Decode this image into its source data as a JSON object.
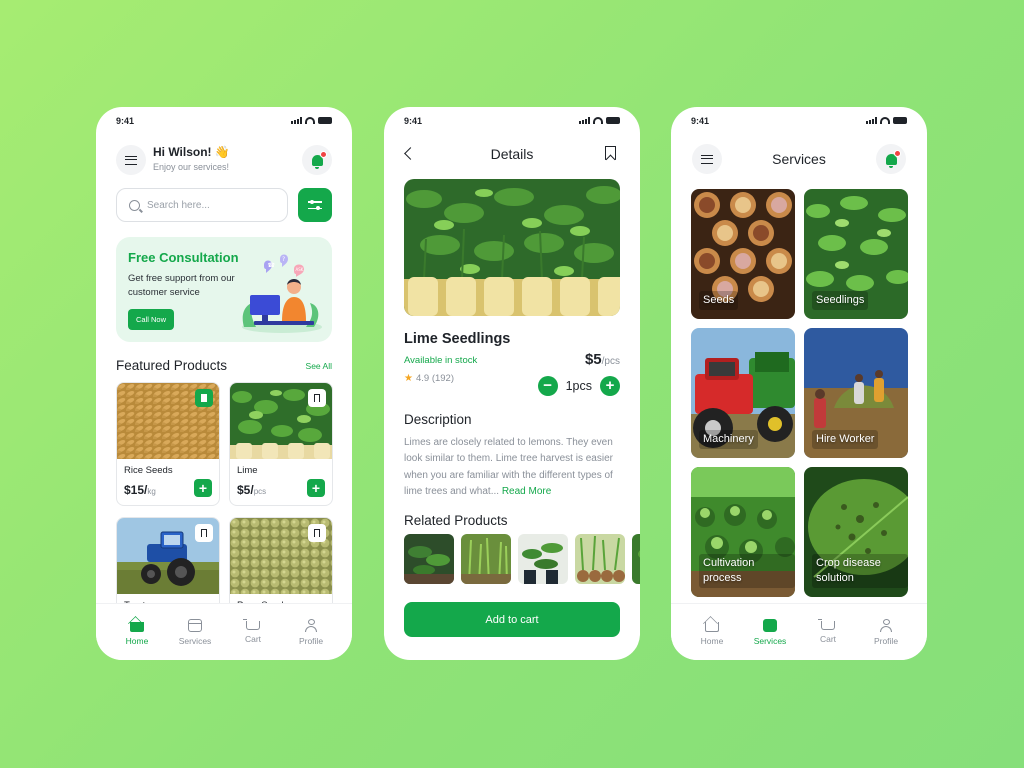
{
  "status": {
    "time": "9:41"
  },
  "home": {
    "greeting": "Hi Wilson! 👋",
    "subtitle": "Enjoy our services!",
    "search_placeholder": "Search here...",
    "banner": {
      "title": "Free Consultation",
      "text": "Get free support from our customer service",
      "button": "Call Now"
    },
    "featured_title": "Featured Products",
    "see_all": "See All",
    "products": [
      {
        "name": "Rice Seeds",
        "price": "$15/",
        "unit": "kg",
        "bookmarked": true
      },
      {
        "name": "Lime",
        "price": "$5/",
        "unit": "pcs",
        "bookmarked": false
      },
      {
        "name": "Tractor",
        "price": "",
        "unit": "",
        "bookmarked": false
      },
      {
        "name": "Peas Seeds",
        "price": "",
        "unit": "",
        "bookmarked": false
      }
    ]
  },
  "tabs": [
    {
      "label": "Home",
      "icon": "home-icon"
    },
    {
      "label": "Services",
      "icon": "services-icon"
    },
    {
      "label": "Cart",
      "icon": "cart-icon"
    },
    {
      "label": "Profile",
      "icon": "profile-icon"
    }
  ],
  "details": {
    "title": "Details",
    "product_name": "Lime Seedlings",
    "availability": "Available in stock",
    "price": "$5",
    "unit": "/pcs",
    "rating": "4.9 (192)",
    "quantity": "1pcs",
    "description_title": "Description",
    "description": "Limes are closely related to lemons. They even look similar to them. Lime tree harvest is easier when you are familiar with the different types of lime trees and what...",
    "read_more": "Read More",
    "related_title": "Related Products",
    "add_to_cart": "Add to cart"
  },
  "services": {
    "title": "Services",
    "items": [
      {
        "label": "Seeds"
      },
      {
        "label": "Seedlings"
      },
      {
        "label": "Machinery"
      },
      {
        "label": "Hire Worker"
      },
      {
        "label": "Cultivation process"
      },
      {
        "label": "Crop disease solution"
      }
    ]
  },
  "colors": {
    "accent": "#14a84b",
    "background": "#9be874",
    "text": "#1f2329",
    "muted": "#8a9099"
  }
}
